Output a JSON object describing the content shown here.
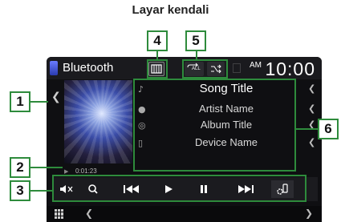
{
  "caption": "Layar kendali",
  "callouts": {
    "c1": "1",
    "c2": "2",
    "c3": "3",
    "c4": "4",
    "c5": "5",
    "c6": "6"
  },
  "source": {
    "label": "Bluetooth",
    "icon": "phone-icon"
  },
  "clock": {
    "ampm": "AM",
    "time": "10:00"
  },
  "mode_buttons": {
    "repeat_label": "ALL",
    "repeat_icon": "repeat-icon",
    "shuffle_icon": "shuffle-icon",
    "display_icon": "display-mode-icon"
  },
  "track": {
    "song_title": "Song Title",
    "artist_name": "Artist Name",
    "album_title": "Album Title",
    "device_name": "Device Name"
  },
  "playback": {
    "elapsed": "0:01:23"
  },
  "controls": [
    "mute-icon",
    "search-icon",
    "previous-track-icon",
    "play-icon",
    "pause-icon",
    "next-track-icon",
    "settings-phone-icon"
  ],
  "colors": {
    "callout_border": "#2e8b3c",
    "screen_bg": "#0f0f12"
  }
}
